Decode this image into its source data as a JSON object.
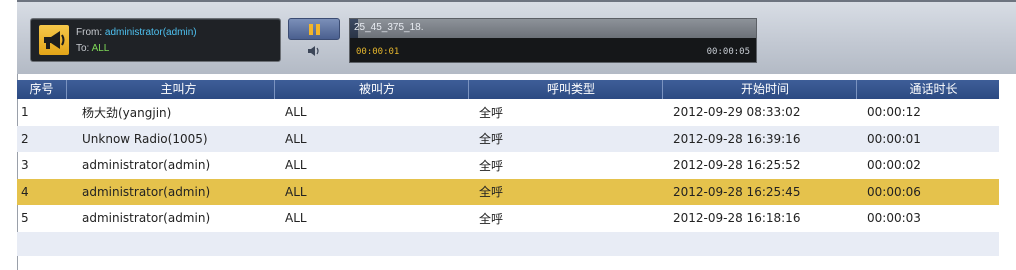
{
  "player": {
    "from_label": "From:",
    "from_value": "administrator(admin)",
    "to_label": "To:",
    "to_value": "ALL",
    "track_name": "25_45_375_18.",
    "progress_fraction": 0.02,
    "time_current": "00:00:01",
    "time_total": "00:00:05"
  },
  "table": {
    "columns": [
      "序号",
      "主叫方",
      "被叫方",
      "呼叫类型",
      "开始时间",
      "通话时长"
    ],
    "rows": [
      [
        "1",
        "杨大劲(yangjin)",
        "ALL",
        "全呼",
        "2012-09-29 08:33:02",
        "00:00:12"
      ],
      [
        "2",
        "Unknow Radio(1005)",
        "ALL",
        "全呼",
        "2012-09-28 16:39:16",
        "00:00:01"
      ],
      [
        "3",
        "administrator(admin)",
        "ALL",
        "全呼",
        "2012-09-28 16:25:52",
        "00:00:02"
      ],
      [
        "4",
        "administrator(admin)",
        "ALL",
        "全呼",
        "2012-09-28 16:25:45",
        "00:00:06"
      ],
      [
        "5",
        "administrator(admin)",
        "ALL",
        "全呼",
        "2012-09-28 16:18:16",
        "00:00:03"
      ]
    ],
    "selected_row": 3
  },
  "colors": {
    "header_bg": "#3e5e98",
    "selected_row": "#e5c24c",
    "alt_row": "#e8ecf5",
    "from_text": "#4ec1f0",
    "to_text": "#7ed957",
    "time_current": "#e3b52d"
  },
  "icons": {
    "speaker": "megaphone-icon",
    "pause": "pause-icon",
    "volume": "volume-icon"
  }
}
